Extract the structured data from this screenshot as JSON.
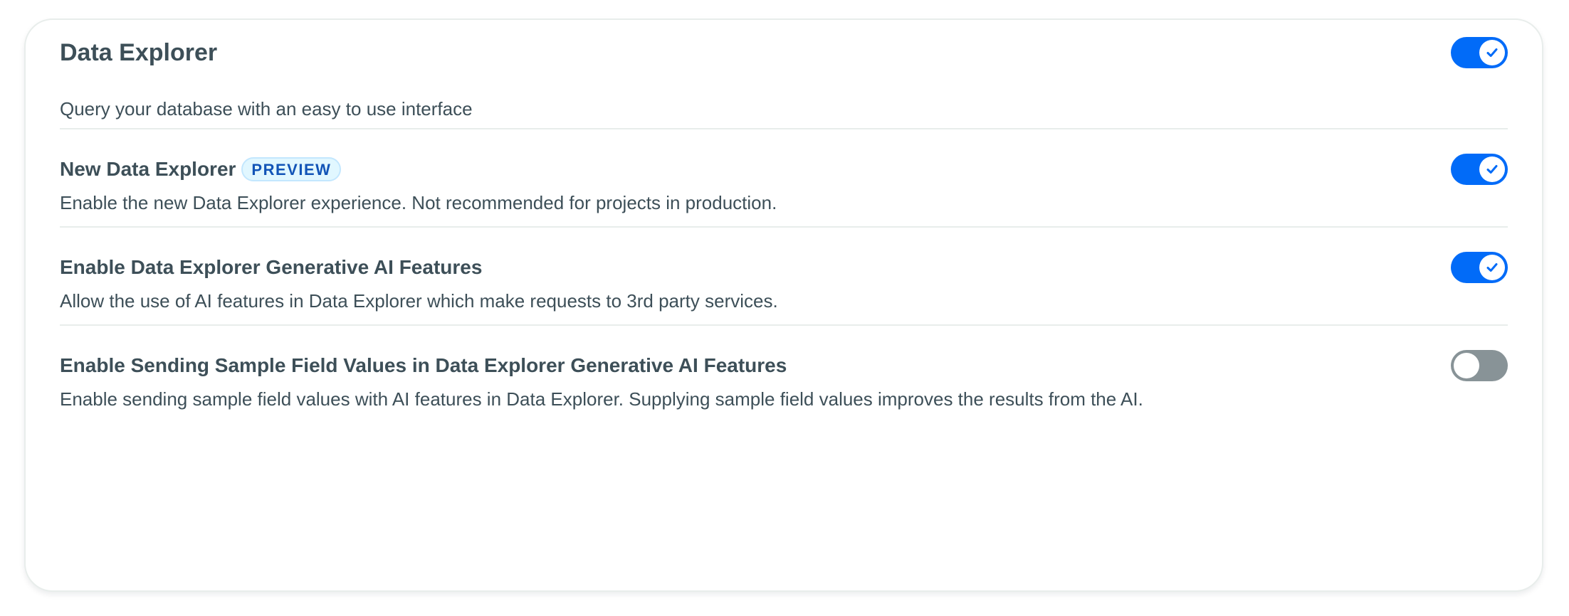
{
  "main": {
    "title": "Data Explorer",
    "description": "Query your database with an easy to use interface",
    "toggle_state": "on"
  },
  "settings": [
    {
      "title": "New Data Explorer",
      "badge": "PREVIEW",
      "description": "Enable the new Data Explorer experience. Not recommended for projects in production.",
      "toggle_state": "on"
    },
    {
      "title": "Enable Data Explorer Generative AI Features",
      "description": "Allow the use of AI features in Data Explorer which make requests to 3rd party services.",
      "toggle_state": "on"
    },
    {
      "title": "Enable Sending Sample Field Values in Data Explorer Generative AI Features",
      "description": "Enable sending sample field values with AI features in Data Explorer. Supplying sample field values improves the results from the AI.",
      "toggle_state": "off"
    }
  ],
  "colors": {
    "toggle_on": "#016bf8",
    "toggle_off": "#889397",
    "badge_text": "#1254b7",
    "badge_bg": "#e1f7ff",
    "text": "#3d4f58"
  },
  "icons": {
    "toggle_on_knob": "checkmark-icon"
  }
}
